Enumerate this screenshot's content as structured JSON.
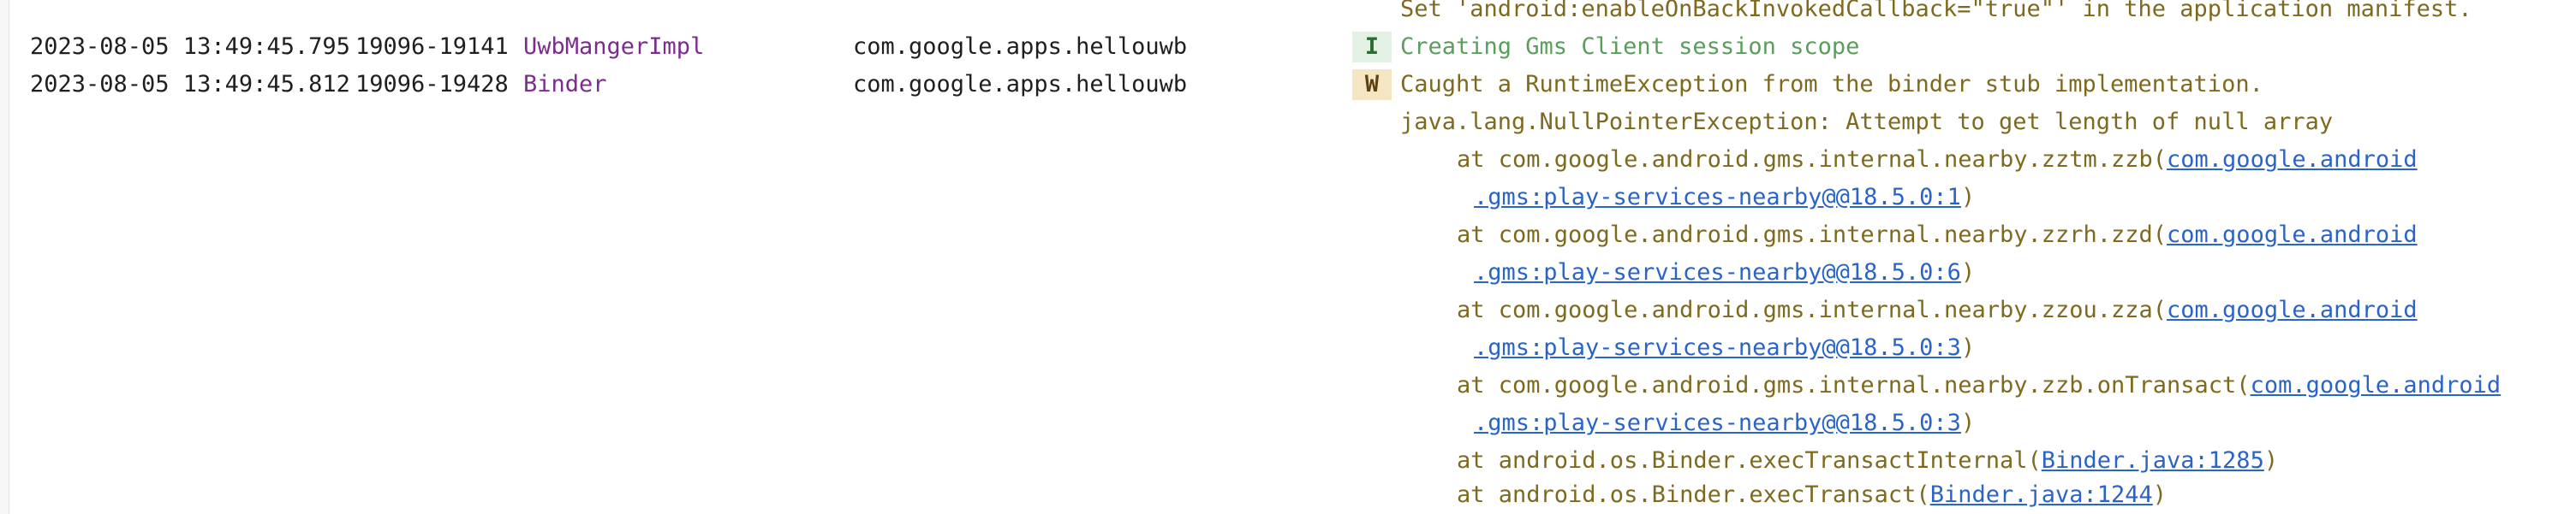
{
  "log_entries": [
    {
      "timestamp": "2023-08-05 13:49:45.795",
      "pid_tid": "19096-19141",
      "tag": "UwbMangerImpl",
      "tag_color": "#7b2d8e",
      "package": "com.google.apps.hellouwb",
      "level": "I",
      "message": "Creating Gms Client session scope"
    },
    {
      "timestamp": "2023-08-05 13:49:45.812",
      "pid_tid": "19096-19428",
      "tag": "Binder",
      "tag_color": "#7b2d8e",
      "package": "com.google.apps.hellouwb",
      "level": "W",
      "message": "Caught a RuntimeException from the binder stub implementation."
    }
  ],
  "previous_message_tail": "Set 'android:enableOnBackInvokedCallback=\"true\"' in the application manifest.",
  "exception_line": "java.lang.NullPointerException: Attempt to get length of null array",
  "stack_frames": [
    {
      "prefix": "at com.google.android.gms.internal.nearby.zztm.zzb(",
      "link_part1": "com.google.android",
      "link_part2": ".gms:play-services-nearby@@18.5.0:1",
      "suffix": ")"
    },
    {
      "prefix": "at com.google.android.gms.internal.nearby.zzrh.zzd(",
      "link_part1": "com.google.android",
      "link_part2": ".gms:play-services-nearby@@18.5.0:6",
      "suffix": ")"
    },
    {
      "prefix": "at com.google.android.gms.internal.nearby.zzou.zza(",
      "link_part1": "com.google.android",
      "link_part2": ".gms:play-services-nearby@@18.5.0:3",
      "suffix": ")"
    },
    {
      "prefix": "at com.google.android.gms.internal.nearby.zzb.onTransact(",
      "link_part1": "com.google.android",
      "link_part2": ".gms:play-services-nearby@@18.5.0:3",
      "suffix": ")"
    },
    {
      "prefix": "at android.os.Binder.execTransactInternal(",
      "link_part1": "Binder.java:1285",
      "suffix": ")"
    },
    {
      "prefix": "at android.os.Binder.execTransact(",
      "link_part1": "Binder.java:1244",
      "suffix": ")"
    }
  ]
}
